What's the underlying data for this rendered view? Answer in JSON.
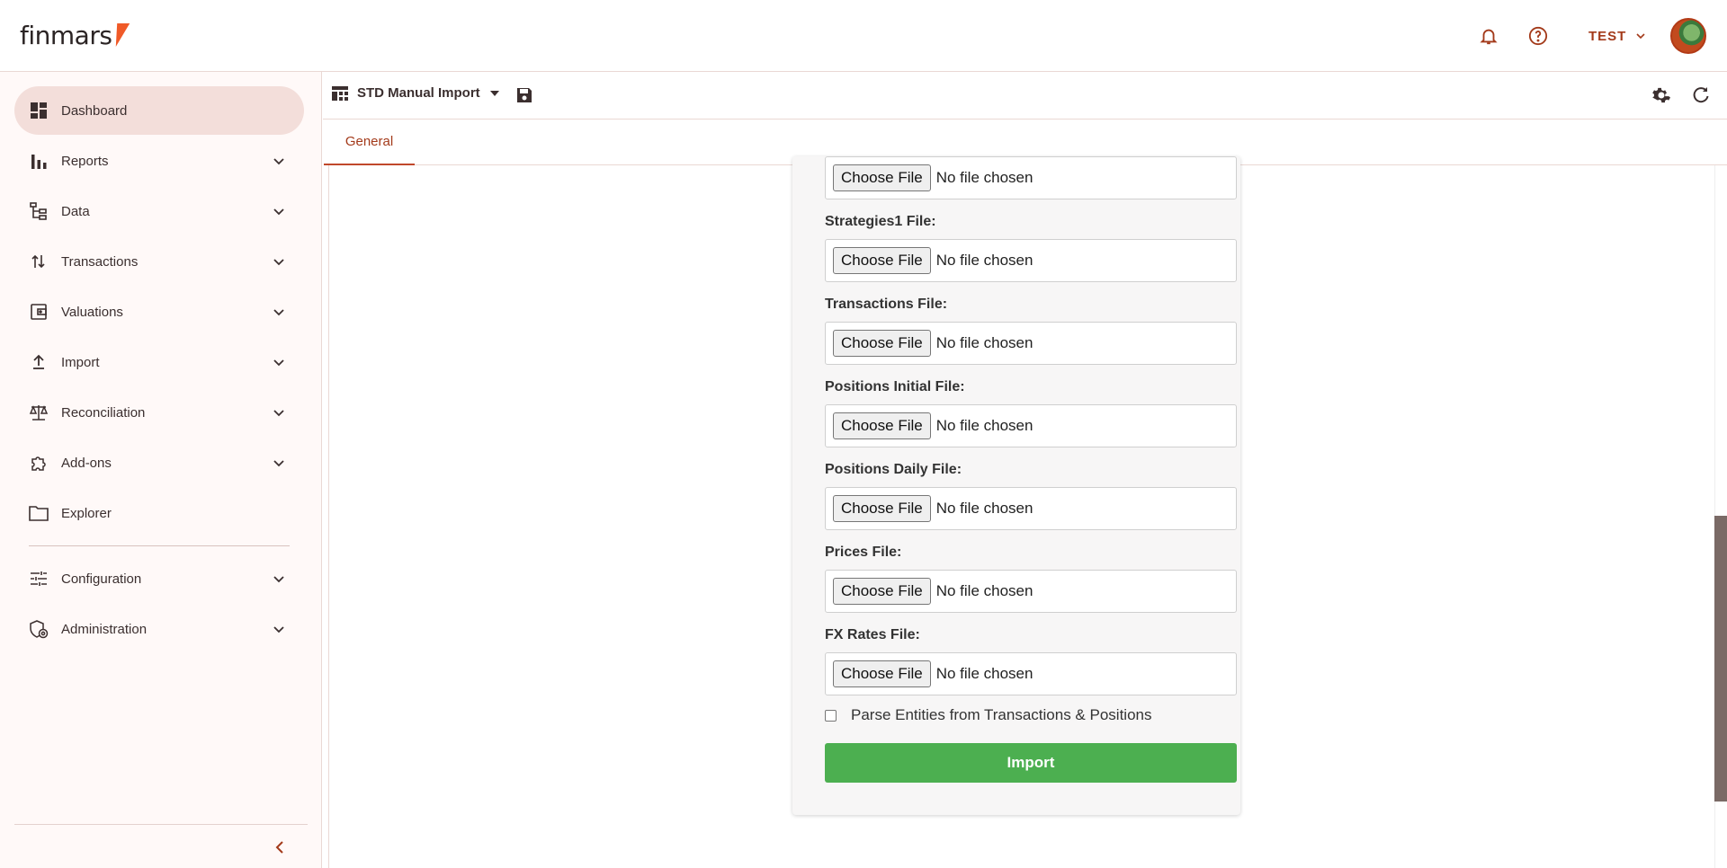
{
  "app": {
    "logo_text": "finmars",
    "user_name": "TEST",
    "brand_color": "#f05a28",
    "accent_color": "#a33a1a"
  },
  "topbar": {
    "icons": [
      "bell-icon",
      "help-icon"
    ]
  },
  "sidebar": {
    "items": [
      {
        "label": "Dashboard",
        "icon": "dashboard-icon",
        "active": true,
        "expandable": false
      },
      {
        "label": "Reports",
        "icon": "bar-chart-icon",
        "expandable": true
      },
      {
        "label": "Data",
        "icon": "tree-icon",
        "expandable": true
      },
      {
        "label": "Transactions",
        "icon": "swap-vertical-icon",
        "expandable": true
      },
      {
        "label": "Valuations",
        "icon": "wallet-icon",
        "expandable": true
      },
      {
        "label": "Import",
        "icon": "upload-icon",
        "expandable": true
      },
      {
        "label": "Reconciliation",
        "icon": "scale-icon",
        "expandable": true
      },
      {
        "label": "Add-ons",
        "icon": "puzzle-icon",
        "expandable": true
      },
      {
        "label": "Explorer",
        "icon": "folder-icon",
        "expandable": false
      },
      {
        "label": "Configuration",
        "icon": "tune-icon",
        "expandable": true
      },
      {
        "label": "Administration",
        "icon": "admin-shield-icon",
        "expandable": true
      }
    ]
  },
  "header": {
    "layout_title": "STD Manual Import"
  },
  "tabs": [
    {
      "label": "General",
      "active": true
    }
  ],
  "form": {
    "choose_label": "Choose File",
    "no_file_label": "No file chosen",
    "fields": [
      {
        "label": ""
      },
      {
        "label": "Strategies1 File:"
      },
      {
        "label": "Transactions File:"
      },
      {
        "label": "Positions Initial File:"
      },
      {
        "label": "Positions Daily File:"
      },
      {
        "label": "Prices File:"
      },
      {
        "label": "FX Rates File:"
      }
    ],
    "parse_label": "Parse Entities from Transactions & Positions",
    "parse_checked": false,
    "import_label": "Import",
    "import_color": "#4caf50"
  }
}
